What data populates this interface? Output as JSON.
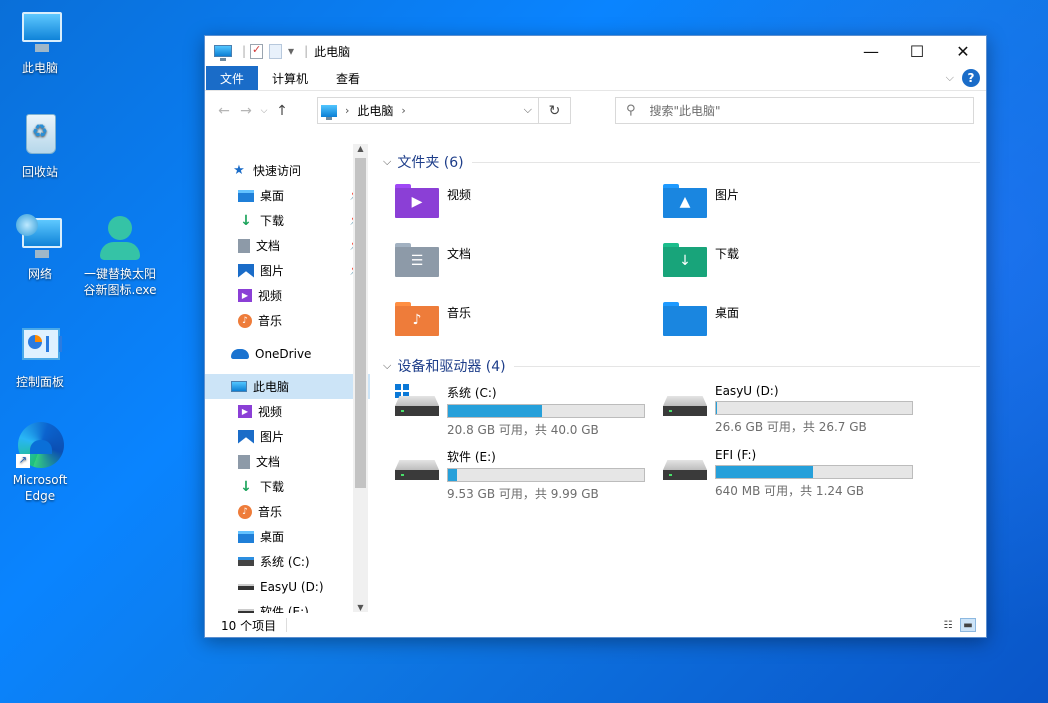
{
  "desktop": {
    "icons": [
      {
        "label": "此电脑",
        "icon": "computer-icon"
      },
      {
        "label": "回收站",
        "icon": "recycle-bin-icon"
      },
      {
        "label": "网络",
        "icon": "network-icon"
      },
      {
        "label": "一键替换太阳谷新图标.exe",
        "icon": "app-user-icon"
      },
      {
        "label": "控制面板",
        "icon": "control-panel-icon"
      },
      {
        "label": "Microsoft Edge",
        "icon": "edge-icon"
      }
    ]
  },
  "window": {
    "title": "此电脑",
    "controls": {
      "minimize": "—",
      "maximize": "☐",
      "close": "✕"
    },
    "quick_access_separator": "|",
    "quick_access_dropdown": "▾",
    "ribbon": {
      "file": "文件",
      "computer": "计算机",
      "view": "查看",
      "expand": "⌵",
      "help": "?"
    },
    "nav": {
      "back": "←",
      "forward": "→",
      "recent": "⌵",
      "up": "↑",
      "address": "此电脑",
      "address_arrow_left": "›",
      "address_arrow_right": "›",
      "address_dropdown": "⌵",
      "refresh": "↻",
      "search_placeholder": "搜索\"此电脑\"",
      "search_icon": "⚲"
    },
    "navpane": {
      "quick_access": "快速访问",
      "qa_items": [
        {
          "label": "桌面",
          "icon": "desktop-icon",
          "pinned": true
        },
        {
          "label": "下载",
          "icon": "download-icon",
          "pinned": true
        },
        {
          "label": "文档",
          "icon": "document-icon",
          "pinned": true
        },
        {
          "label": "图片",
          "icon": "pictures-icon",
          "pinned": true
        },
        {
          "label": "视频",
          "icon": "video-icon",
          "pinned": false
        },
        {
          "label": "音乐",
          "icon": "music-icon",
          "pinned": false
        }
      ],
      "pin_glyph": "📌",
      "onedrive": "OneDrive",
      "this_pc": "此电脑",
      "pc_items": [
        {
          "label": "视频",
          "icon": "video-icon"
        },
        {
          "label": "图片",
          "icon": "pictures-icon"
        },
        {
          "label": "文档",
          "icon": "document-icon"
        },
        {
          "label": "下载",
          "icon": "download-icon"
        },
        {
          "label": "音乐",
          "icon": "music-icon"
        },
        {
          "label": "桌面",
          "icon": "desktop-icon"
        },
        {
          "label": "系统 (C:)",
          "icon": "system-drive-icon"
        },
        {
          "label": "EasyU (D:)",
          "icon": "drive-icon"
        },
        {
          "label": "软件 (E:)",
          "icon": "drive-icon"
        }
      ],
      "scroll_up": "▲",
      "scroll_down": "▼"
    },
    "content": {
      "folders_header": "文件夹 (6)",
      "folders": [
        {
          "label": "视频",
          "color": "#8b3fd6",
          "glyph": "▶"
        },
        {
          "label": "图片",
          "color": "#1a86e0",
          "glyph": "▲"
        },
        {
          "label": "文档",
          "color": "#8d9aa8",
          "glyph": "☰"
        },
        {
          "label": "下载",
          "color": "#18a47a",
          "glyph": "↓"
        },
        {
          "label": "音乐",
          "color": "#ee7c3a",
          "glyph": "♪"
        },
        {
          "label": "桌面",
          "color": "#1a86e0",
          "glyph": ""
        }
      ],
      "drives_header": "设备和驱动器 (4)",
      "drives": [
        {
          "label": "系统 (C:)",
          "free_text": "20.8 GB 可用，共 40.0 GB",
          "used_pct": 48,
          "system": true
        },
        {
          "label": "EasyU (D:)",
          "free_text": "26.6 GB 可用，共 26.7 GB",
          "used_pct": 0.4,
          "system": false
        },
        {
          "label": "软件 (E:)",
          "free_text": "9.53 GB 可用，共 9.99 GB",
          "used_pct": 4.6,
          "system": false
        },
        {
          "label": "EFI (F:)",
          "free_text": "640 MB 可用，共 1.24 GB",
          "used_pct": 49.6,
          "system": false
        }
      ]
    },
    "status": {
      "count": "10 个项目"
    }
  }
}
